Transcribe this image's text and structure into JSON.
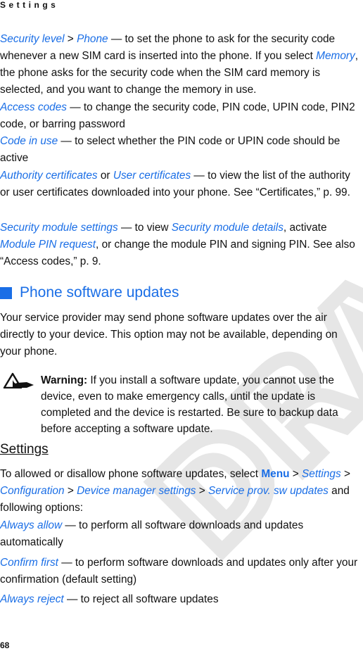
{
  "header": {
    "running_title": "Settings"
  },
  "security_options": [
    {
      "parts": [
        {
          "t": "Security level",
          "k": "link"
        },
        {
          "t": " > ",
          "k": "text"
        },
        {
          "t": "Phone",
          "k": "link"
        },
        {
          "t": " — to set the phone to ask for the security code whenever a new SIM card is inserted into the phone. If you select ",
          "k": "text"
        },
        {
          "t": "Memory",
          "k": "link"
        },
        {
          "t": ", the phone asks for the security code when the SIM card memory is selected, and you want to change the memory in use.",
          "k": "text"
        }
      ]
    },
    {
      "parts": [
        {
          "t": "Access codes",
          "k": "link"
        },
        {
          "t": " — to change the security code, PIN code, UPIN code, PIN2 code, or barring password",
          "k": "text"
        }
      ]
    },
    {
      "parts": [
        {
          "t": "Code in use",
          "k": "link"
        },
        {
          "t": " — to select whether the PIN code or UPIN code should be active",
          "k": "text"
        }
      ]
    },
    {
      "parts": [
        {
          "t": "Authority certificates",
          "k": "link"
        },
        {
          "t": " or ",
          "k": "text"
        },
        {
          "t": "User certificates",
          "k": "link"
        },
        {
          "t": " — to view the list of the authority or user certificates downloaded into your phone. See “Certificates,” p. 99.",
          "k": "text"
        }
      ]
    },
    {
      "parts": [
        {
          "t": "Security module settings",
          "k": "link"
        },
        {
          "t": " — to view ",
          "k": "text"
        },
        {
          "t": "Security module details",
          "k": "link"
        },
        {
          "t": ", activate ",
          "k": "text"
        },
        {
          "t": "Module PIN request",
          "k": "link"
        },
        {
          "t": ", or change the module PIN and signing PIN. See also “Access codes,” p. 9.",
          "k": "text"
        }
      ]
    }
  ],
  "section": {
    "title": "Phone software updates",
    "intro": "Your service provider may send phone software updates over the air directly to your device. This option may not be available, depending on your phone.",
    "warning_label": "Warning:",
    "warning_text": " If you install a software update, you cannot use the device, even to make emergency calls, until the update is completed and the device is restarted. Be sure to backup data before accepting a software update.",
    "subheading": "Settings",
    "instructions": [
      {
        "t": "To allowed or disallow phone software updates, select ",
        "k": "text"
      },
      {
        "t": "Menu",
        "k": "menu"
      },
      {
        "t": " > ",
        "k": "text"
      },
      {
        "t": "Settings",
        "k": "link"
      },
      {
        "t": " > ",
        "k": "text"
      },
      {
        "t": "Configuration",
        "k": "link"
      },
      {
        "t": " > ",
        "k": "text"
      },
      {
        "t": "Device manager settings",
        "k": "link"
      },
      {
        "t": " > ",
        "k": "text"
      },
      {
        "t": "Service prov. sw updates",
        "k": "link"
      },
      {
        "t": " and following options:",
        "k": "text"
      }
    ],
    "options": [
      {
        "label": "Always allow",
        "desc": " — to perform all software downloads and updates automatically"
      },
      {
        "label": "Confirm first",
        "desc": " — to perform software downloads and updates only after your confirmation (default setting)"
      },
      {
        "label": "Always reject",
        "desc": " — to reject all software updates"
      }
    ]
  },
  "watermark": "DRAFT",
  "footer": {
    "page_number": "68"
  },
  "colors": {
    "link": "#1a6ee6",
    "text": "#111111",
    "watermark": "#e6e6e6"
  }
}
